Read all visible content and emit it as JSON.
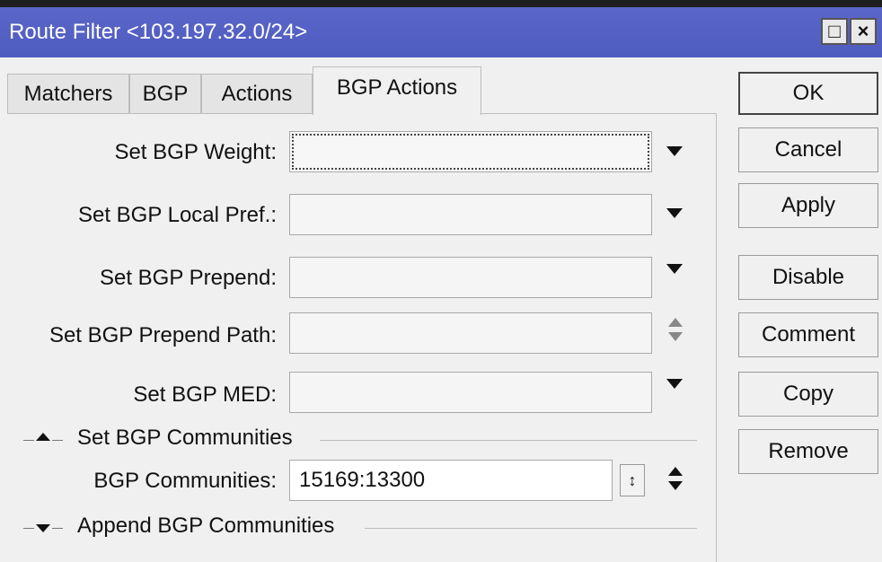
{
  "window": {
    "title": "Route Filter <103.197.32.0/24>",
    "restore_glyph": "□",
    "close_glyph": "×"
  },
  "tabs": [
    {
      "label": "Matchers",
      "active": false
    },
    {
      "label": "BGP",
      "active": false
    },
    {
      "label": "Actions",
      "active": false
    },
    {
      "label": "BGP Actions",
      "active": true
    }
  ],
  "form": {
    "set_bgp_weight": {
      "label": "Set BGP Weight:",
      "value": ""
    },
    "set_bgp_local_pref": {
      "label": "Set BGP Local Pref.:",
      "value": ""
    },
    "set_bgp_prepend": {
      "label": "Set BGP Prepend:",
      "value": ""
    },
    "set_bgp_prepend_path": {
      "label": "Set BGP Prepend Path:",
      "value": ""
    },
    "set_bgp_med": {
      "label": "Set BGP MED:",
      "value": ""
    }
  },
  "sections": {
    "set_communities": {
      "title": "Set BGP Communities",
      "expanded": true,
      "field_label": "BGP Communities:",
      "field_value": "15169:13300",
      "remove_glyph": "↕"
    },
    "append_communities": {
      "title": "Append BGP Communities",
      "expanded": false
    }
  },
  "buttons": {
    "ok": "OK",
    "cancel": "Cancel",
    "apply": "Apply",
    "disable": "Disable",
    "comment": "Comment",
    "copy": "Copy",
    "remove": "Remove"
  },
  "colors": {
    "titlebar": "#5060c4",
    "window_bg": "#f0f0f0",
    "frame": "#1e1e1e"
  }
}
